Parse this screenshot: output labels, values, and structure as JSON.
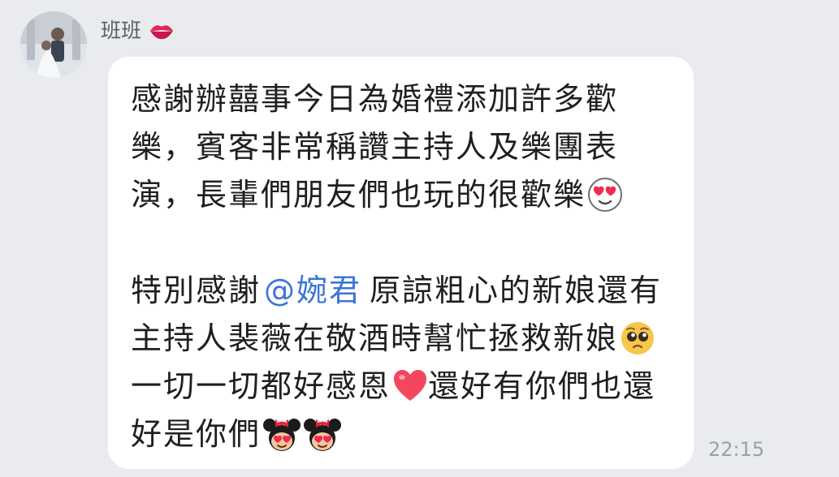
{
  "message": {
    "sender_name": "班班",
    "name_emoji": "kiss-mark-icon",
    "timestamp": "22:15",
    "lines": [
      "感謝辦囍事今日為婚禮添加許多歡",
      "樂，賓客非常稱讚主持人及樂團表",
      "演，長輩們朋友們也玩的很歡樂",
      "",
      "特別感謝",
      "原諒粗心的新娘還有",
      "主持人裴薇在敬酒時幫忙拯救新娘",
      "一切一切都好感恩",
      "還好有你們也還",
      "好是你們"
    ],
    "mention": "@婉君",
    "emojis": [
      "heart-eyes-face-icon",
      "pleading-face-icon",
      "heart-icon",
      "minnie-heart-eyes-icon",
      "minnie-heart-eyes-icon"
    ]
  },
  "colors": {
    "background": "#e9ebef",
    "bubble": "#ffffff",
    "mention": "#3b74d8",
    "text": "#1f1f1f",
    "sender": "#5a5f68",
    "timestamp": "#9aa0a8"
  }
}
